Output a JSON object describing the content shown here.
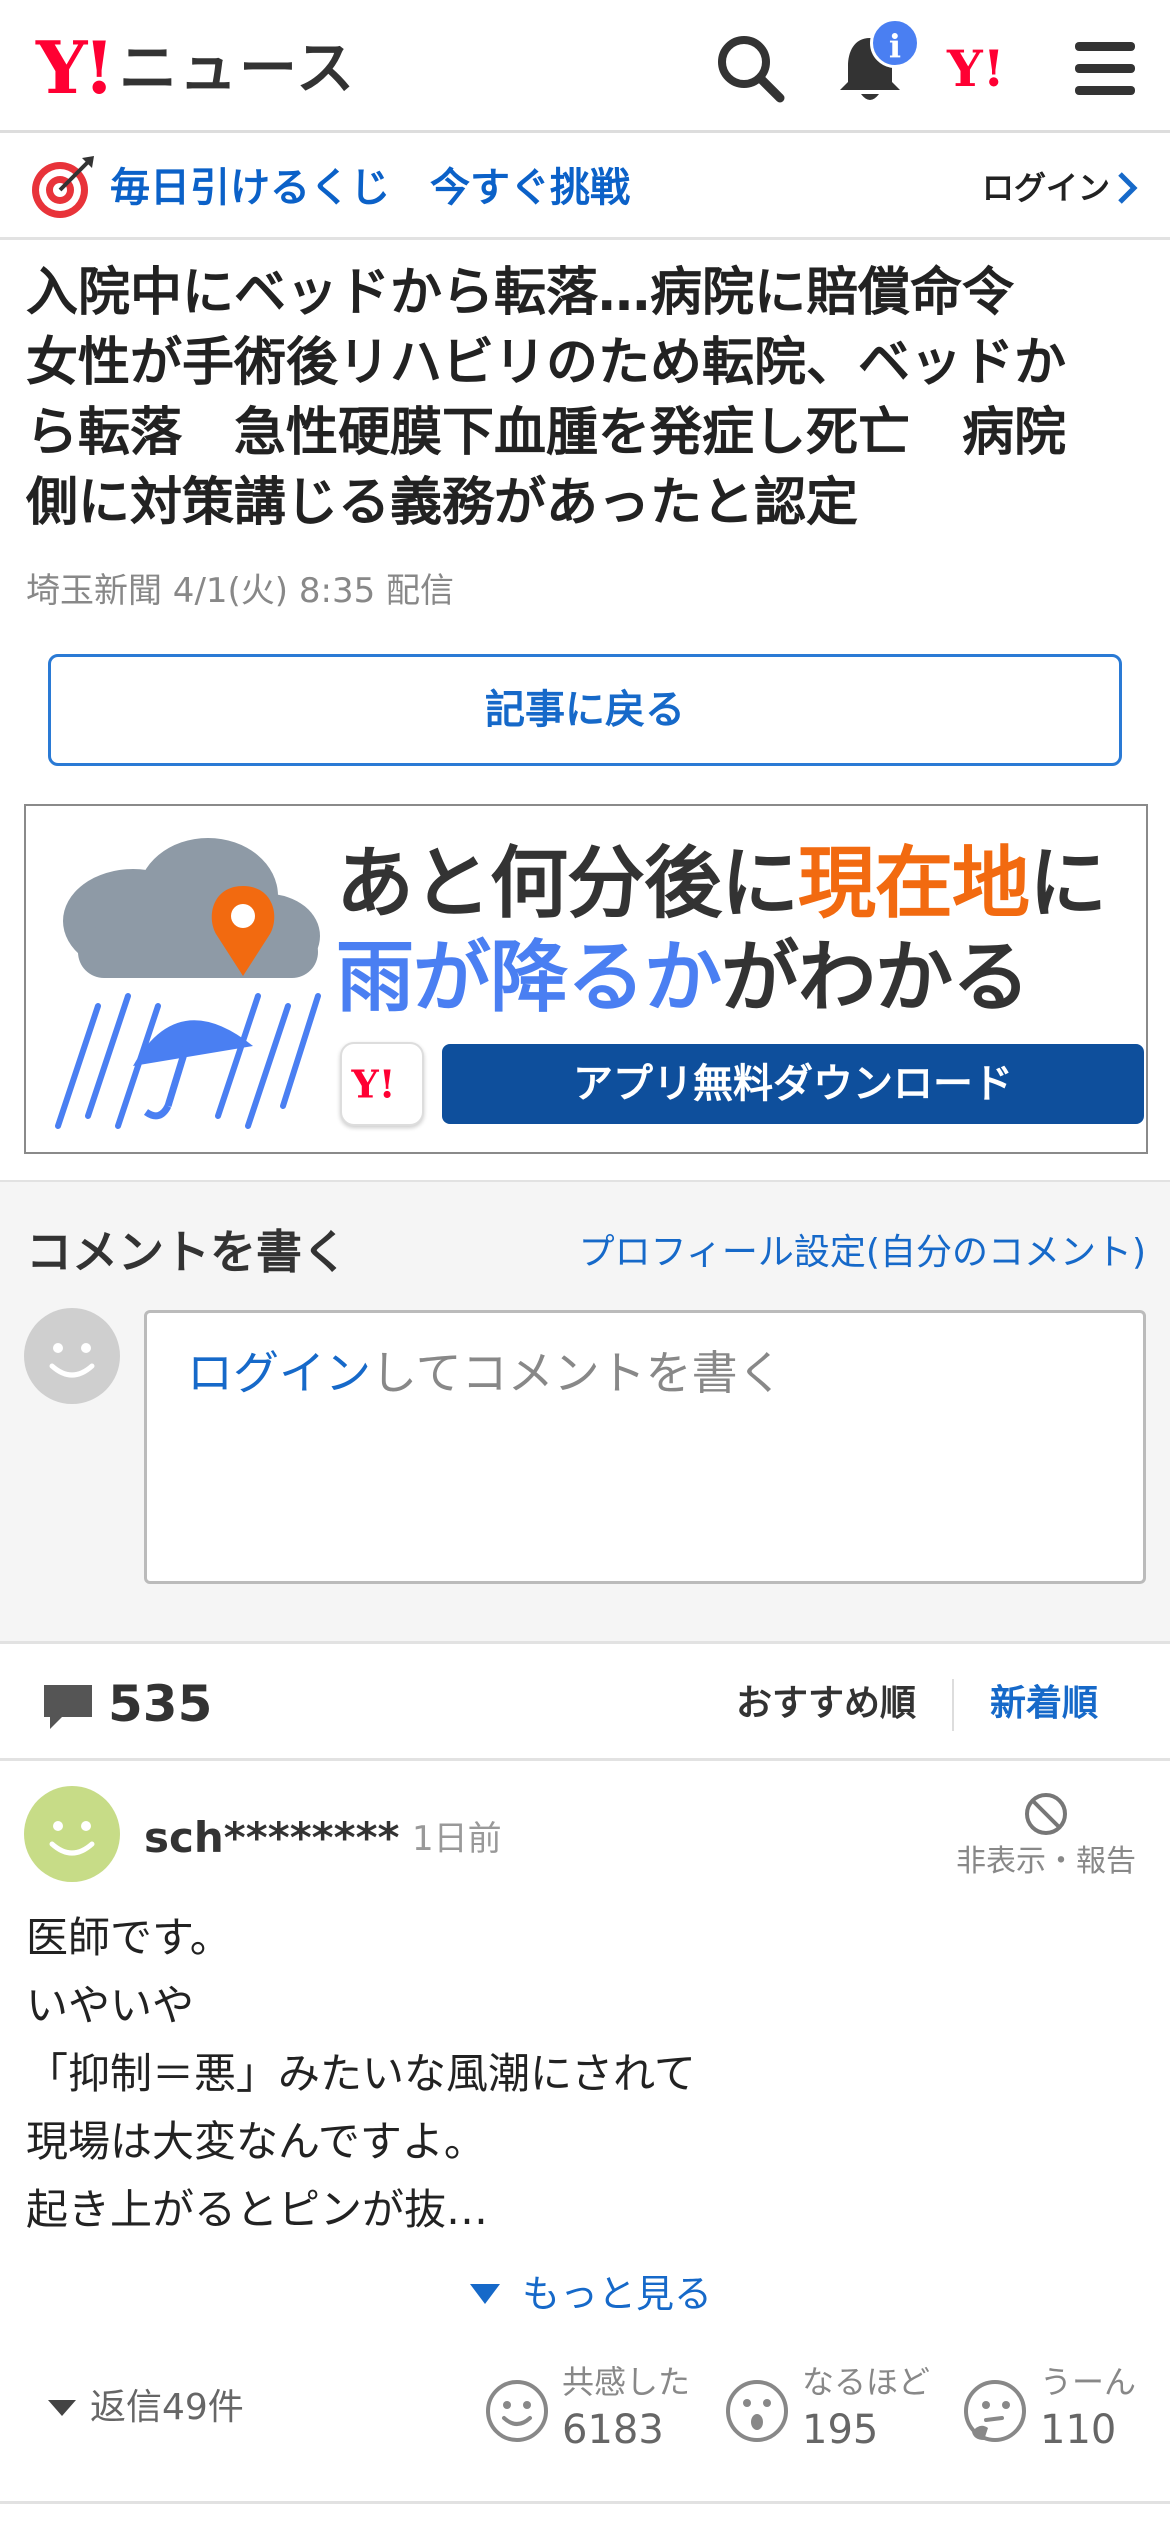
{
  "header": {
    "logo_mark": "Y!",
    "logo_text": "ニュース",
    "notification_badge": "i",
    "icons": [
      "search-icon",
      "bell-icon",
      "yahoo-japan-icon",
      "menu-icon"
    ]
  },
  "lottery": {
    "text": "毎日引けるくじ　今すぐ挑戦",
    "login_label": "ログイン"
  },
  "article": {
    "title_lines": [
      "入院中にベッドから転落…病院に賠償命令",
      "女性が手術後リハビリのため転院、ベッドか",
      "ら転落　急性硬膜下血腫を発症し死亡　病院",
      "側に対策講じる義務があったと認定"
    ],
    "meta": "埼玉新聞 4/1(火) 8:35 配信",
    "back_button": "記事に戻る"
  },
  "ad": {
    "line1_a": "あと何分後に",
    "line1_b": "現在地",
    "line1_c": "に",
    "line2_a": "雨が降るか",
    "line2_b": "がわかる",
    "button": "アプリ無料ダウンロード",
    "colors": {
      "orange": "#f26a10",
      "blue": "#4a7ff2",
      "button_bg": "#0e4f9c"
    }
  },
  "comment_write": {
    "title": "コメントを書く",
    "profile_link": "プロフィール設定(自分のコメント)",
    "placeholder_link": "ログイン",
    "placeholder_rest": "してコメントを書く"
  },
  "stats": {
    "comment_count": "535",
    "sort_recommended": "おすすめ順",
    "sort_new": "新着順"
  },
  "comment": {
    "user": "sch********",
    "time": "1日前",
    "hide_report": "非表示・報告",
    "body_lines": [
      "医師です。",
      "いやいや",
      "「抑制＝悪」みたいな風潮にされて",
      "現場は大変なんですよ。",
      "起き上がるとピンが抜…"
    ],
    "more": "もっと見る",
    "replies": "返信49件",
    "reactions": [
      {
        "label": "共感した",
        "count": "6183",
        "icon": "smile-icon"
      },
      {
        "label": "なるほど",
        "count": "195",
        "icon": "surprised-icon"
      },
      {
        "label": "うーん",
        "count": "110",
        "icon": "thinking-icon"
      }
    ]
  },
  "colors": {
    "link_blue": "#1669c9",
    "yahoo_red": "#ff0033"
  }
}
